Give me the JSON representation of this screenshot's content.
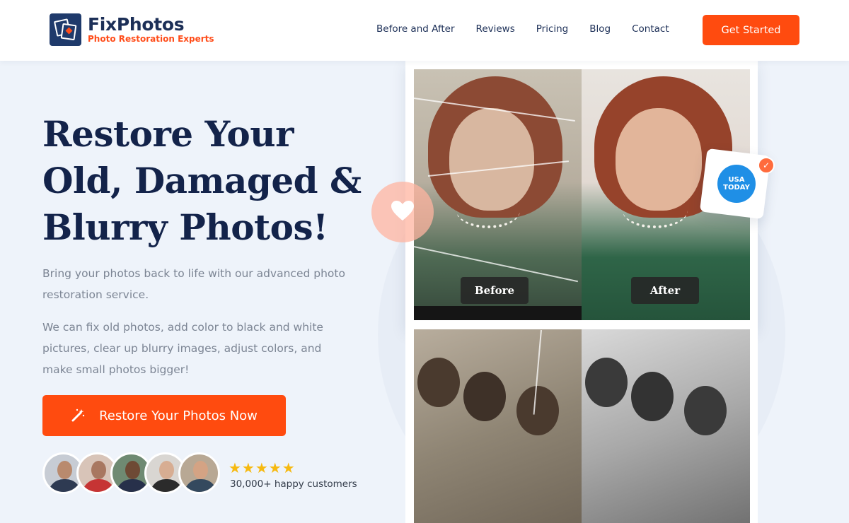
{
  "brand": {
    "name": "FixPhotos",
    "tagline": "Photo Restoration Experts"
  },
  "nav": {
    "items": [
      "Before and After",
      "Reviews",
      "Pricing",
      "Blog",
      "Contact"
    ]
  },
  "header": {
    "cta_label": "Get Started"
  },
  "hero": {
    "title": "Restore Your Old, Damaged & Blurry Photos!",
    "paragraph1": "Bring your photos back to life with our advanced photo restoration service.",
    "paragraph2": "We can fix old photos, add color to black and white pictures, clear up blurry images, adjust colors, and make small photos bigger!",
    "cta_label": "Restore Your Photos Now",
    "rating_stars": "★★★★★",
    "rating_value": 5,
    "social_proof": "30,000+ happy customers"
  },
  "comparison": {
    "before_label": "Before",
    "after_label": "After"
  },
  "badge": {
    "text": "USA TODAY"
  },
  "icons": [
    "logo-icon",
    "magic-wand-icon",
    "heart-icon",
    "check-icon",
    "star-icon"
  ],
  "colors": {
    "accent": "#ff4b0f",
    "navy": "#13234a",
    "badge_blue": "#1f8fe6"
  }
}
